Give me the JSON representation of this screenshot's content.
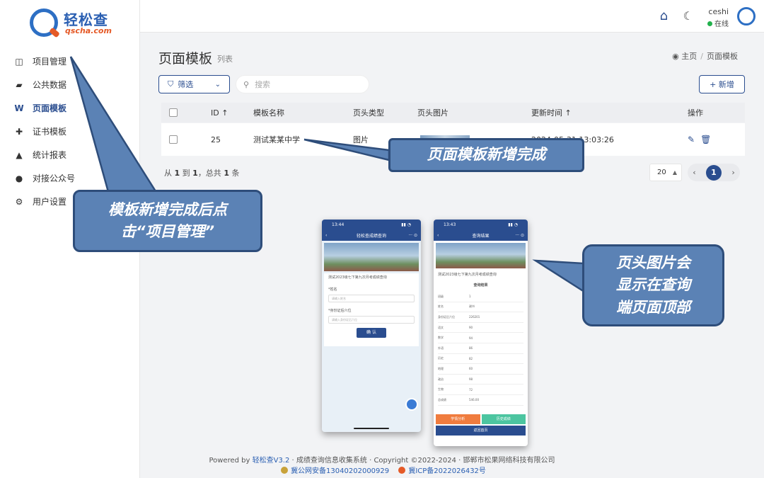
{
  "brand": {
    "name_cn": "轻松查",
    "name_en": "qscha.com"
  },
  "sidebar": {
    "items": [
      {
        "label": "项目管理",
        "icon": "book-open-icon",
        "active": false
      },
      {
        "label": "公共数据",
        "icon": "book-icon",
        "active": false
      },
      {
        "label": "页面模板",
        "icon": "wordpress-icon",
        "active": true
      },
      {
        "label": "证书模板",
        "icon": "puzzle-icon",
        "active": false
      },
      {
        "label": "统计报表",
        "icon": "area-chart-icon",
        "active": false
      },
      {
        "label": "对接公众号",
        "icon": "chat-icon",
        "active": false
      },
      {
        "label": "用户设置",
        "icon": "gears-icon",
        "active": false
      }
    ]
  },
  "topbar": {
    "user": "ceshi",
    "status": "在线"
  },
  "page": {
    "title": "页面模板",
    "subtitle": "列表"
  },
  "breadcrumb": {
    "home": "主页",
    "current": "页面模板"
  },
  "toolbar": {
    "filter": "筛选",
    "search_placeholder": "搜索",
    "add": "+ 新增"
  },
  "table": {
    "headers": {
      "id": "ID ↑",
      "name": "模板名称",
      "type": "页头类型",
      "image": "页头图片",
      "updated": "更新时间 ↑",
      "actions": "操作"
    },
    "rows": [
      {
        "id": "25",
        "name": "测试某某中学",
        "type": "图片",
        "updated": "2024-05-31 13:03:26"
      }
    ]
  },
  "pagination": {
    "info_pre": "从",
    "from": "1",
    "to_label": "到",
    "to": "1",
    "total_label": "，总共",
    "total": "1",
    "unit": "条",
    "page_size": "20",
    "current": "1"
  },
  "phone_left": {
    "time": "13:44",
    "title": "轻松查成绩查询",
    "notice": "测试2023级七下第九次月考成绩查询",
    "field1": "*姓名",
    "field1_ph": "请输入姓名",
    "field2": "*身份证后六位",
    "field2_ph": "请输入身份证后六位",
    "button": "确 认"
  },
  "phone_right": {
    "time": "13:43",
    "title": "查询结果",
    "notice": "测试2023级七下第九次月考成绩查询",
    "section": "查询结果",
    "rows": [
      [
        "班级",
        "1"
      ],
      [
        "姓名",
        "谢书"
      ],
      [
        "身份证后六位",
        "226201"
      ],
      [
        "语文",
        "90"
      ],
      [
        "数学",
        "94"
      ],
      [
        "外语",
        "86"
      ],
      [
        "历史",
        "82"
      ],
      [
        "地理",
        "60"
      ],
      [
        "政治",
        "98"
      ],
      [
        "生物",
        "72"
      ],
      [
        "总成绩",
        "546.00"
      ]
    ],
    "btn1": "学情分析",
    "btn2": "历史成绩",
    "btn3": "返回首页"
  },
  "callouts": {
    "c1": "页面模板新增完成",
    "c2_line1": "模板新增完成后点",
    "c2_line2": "击“项目管理”",
    "c3_line1": "页头图片会",
    "c3_line2": "显示在查询",
    "c3_line3": "端页面顶部"
  },
  "footer": {
    "powered": "Powered by",
    "brand": "轻松查V3.2",
    "rest": "· 成绩查询信息收集系统 · Copyright ©2022-2024 · 邯郸市松果网络科技有限公司",
    "police": "冀公网安备13040202000929",
    "icp": "冀ICP备2022026432号"
  },
  "colors": {
    "primary": "#2a4d8f",
    "callout_fill": "#5b82b5",
    "callout_border": "#2e4d7a",
    "online": "#22b14c",
    "accent_orange": "#e55a27"
  }
}
